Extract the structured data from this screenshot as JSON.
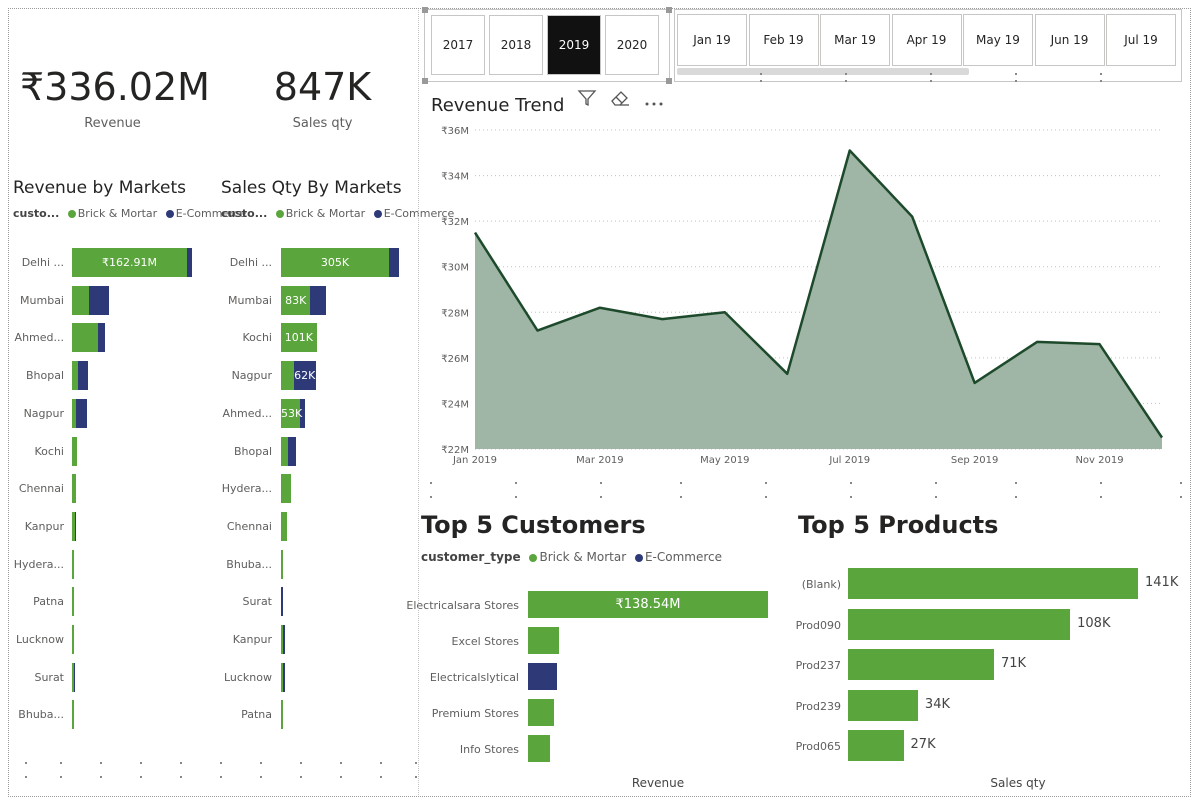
{
  "kpis": {
    "revenue": {
      "value": "₹336.02M",
      "label": "Revenue"
    },
    "sales_qty": {
      "value": "847K",
      "label": "Sales qty"
    }
  },
  "year_slicer": {
    "items": [
      "2017",
      "2018",
      "2019",
      "2020"
    ],
    "selected": "2019"
  },
  "month_slicer": {
    "items": [
      "Jan 19",
      "Feb 19",
      "Mar 19",
      "Apr 19",
      "May 19",
      "Jun 19",
      "Jul 19"
    ]
  },
  "legend": {
    "short_label": "custo...",
    "label": "customer_type",
    "brick": "Brick & Mortar",
    "ecom": "E-Commerce",
    "brick_color": "#5aa53c",
    "ecom_color": "#2e3a78"
  },
  "revenue_by_markets": {
    "title": "Revenue by Markets",
    "rows": [
      {
        "label": "Delhi ...",
        "brick": 162.91,
        "ecom": 7,
        "data_label": "₹162.91M"
      },
      {
        "label": "Mumbai",
        "brick": 24,
        "ecom": 28,
        "data_label": ""
      },
      {
        "label": "Ahmed...",
        "brick": 37,
        "ecom": 10,
        "data_label": ""
      },
      {
        "label": "Bhopal",
        "brick": 9,
        "ecom": 13,
        "data_label": ""
      },
      {
        "label": "Nagpur",
        "brick": 6,
        "ecom": 15,
        "data_label": ""
      },
      {
        "label": "Kochi",
        "brick": 7,
        "ecom": 0,
        "data_label": ""
      },
      {
        "label": "Chennai",
        "brick": 5,
        "ecom": 0,
        "data_label": ""
      },
      {
        "label": "Kanpur",
        "brick": 4,
        "ecom": 0.6,
        "data_label": ""
      },
      {
        "label": "Hydera...",
        "brick": 3,
        "ecom": 0,
        "data_label": ""
      },
      {
        "label": "Patna",
        "brick": 1.5,
        "ecom": 0,
        "data_label": ""
      },
      {
        "label": "Lucknow",
        "brick": 1.5,
        "ecom": 0,
        "data_label": ""
      },
      {
        "label": "Surat",
        "brick": 0.5,
        "ecom": 0.4,
        "data_label": ""
      },
      {
        "label": "Bhuba...",
        "brick": 0.4,
        "ecom": 0,
        "data_label": ""
      }
    ]
  },
  "sales_qty_by_markets": {
    "title": "Sales Qty By Markets",
    "rows": [
      {
        "label": "Delhi ...",
        "brick": 305,
        "ecom": 27,
        "data_label": "305K"
      },
      {
        "label": "Mumbai",
        "brick": 83,
        "ecom": 45,
        "data_label": "83K"
      },
      {
        "label": "Kochi",
        "brick": 101,
        "ecom": 0,
        "data_label": "101K"
      },
      {
        "label": "Nagpur",
        "brick": 36,
        "ecom": 62,
        "data_label": "62K"
      },
      {
        "label": "Ahmed...",
        "brick": 53,
        "ecom": 16,
        "data_label": "53K"
      },
      {
        "label": "Bhopal",
        "brick": 20,
        "ecom": 22,
        "data_label": ""
      },
      {
        "label": "Hydera...",
        "brick": 27,
        "ecom": 0,
        "data_label": ""
      },
      {
        "label": "Chennai",
        "brick": 16,
        "ecom": 0,
        "data_label": ""
      },
      {
        "label": "Bhuba...",
        "brick": 7,
        "ecom": 0,
        "data_label": ""
      },
      {
        "label": "Surat",
        "brick": 0,
        "ecom": 7,
        "data_label": ""
      },
      {
        "label": "Kanpur",
        "brick": 6,
        "ecom": 1,
        "data_label": ""
      },
      {
        "label": "Lucknow",
        "brick": 1,
        "ecom": 6,
        "data_label": ""
      },
      {
        "label": "Patna",
        "brick": 3,
        "ecom": 0,
        "data_label": ""
      }
    ]
  },
  "revenue_trend": {
    "title": "Revenue Trend",
    "icons": [
      "filter-icon",
      "eraser-icon",
      "more-options-icon"
    ]
  },
  "top_customers": {
    "title": "Top 5 Customers",
    "axis_label": "Revenue",
    "rows": [
      {
        "label": "Electricalsara Stores",
        "value": 138.54,
        "type": "brick",
        "data_label": "₹138.54M"
      },
      {
        "label": "Excel Stores",
        "value": 18,
        "type": "brick",
        "data_label": ""
      },
      {
        "label": "Electricalslytical",
        "value": 17,
        "type": "ecom",
        "data_label": ""
      },
      {
        "label": "Premium Stores",
        "value": 15,
        "type": "brick",
        "data_label": ""
      },
      {
        "label": "Info Stores",
        "value": 12.5,
        "type": "brick",
        "data_label": ""
      }
    ]
  },
  "top_products": {
    "title": "Top 5 Products",
    "axis_label": "Sales qty",
    "rows": [
      {
        "label": "(Blank)",
        "value": 141,
        "data_label": "141K"
      },
      {
        "label": "Prod090",
        "value": 108,
        "data_label": "108K"
      },
      {
        "label": "Prod237",
        "value": 71,
        "data_label": "71K"
      },
      {
        "label": "Prod239",
        "value": 34,
        "data_label": "34K"
      },
      {
        "label": "Prod065",
        "value": 27,
        "data_label": "27K"
      }
    ]
  },
  "chart_data": {
    "type": "area",
    "title": "Revenue Trend",
    "x": [
      "Jan 2019",
      "Feb 2019",
      "Mar 2019",
      "Apr 2019",
      "May 2019",
      "Jun 2019",
      "Jul 2019",
      "Aug 2019",
      "Sep 2019",
      "Oct 2019",
      "Nov 2019",
      "Dec 2019"
    ],
    "x_tick_labels": [
      "Jan 2019",
      "Mar 2019",
      "May 2019",
      "Jul 2019",
      "Sep 2019",
      "Nov 2019"
    ],
    "values": [
      31.5,
      27.2,
      28.2,
      27.7,
      28.0,
      25.3,
      35.1,
      32.2,
      24.9,
      26.7,
      26.6,
      22.5
    ],
    "y_tick_labels": [
      "₹22M",
      "₹24M",
      "₹26M",
      "₹28M",
      "₹30M",
      "₹32M",
      "₹34M",
      "₹36M"
    ],
    "ylim": [
      22,
      36
    ],
    "grid": true,
    "fill_color": "#9fb5a5",
    "line_color": "#1e4a2c"
  }
}
